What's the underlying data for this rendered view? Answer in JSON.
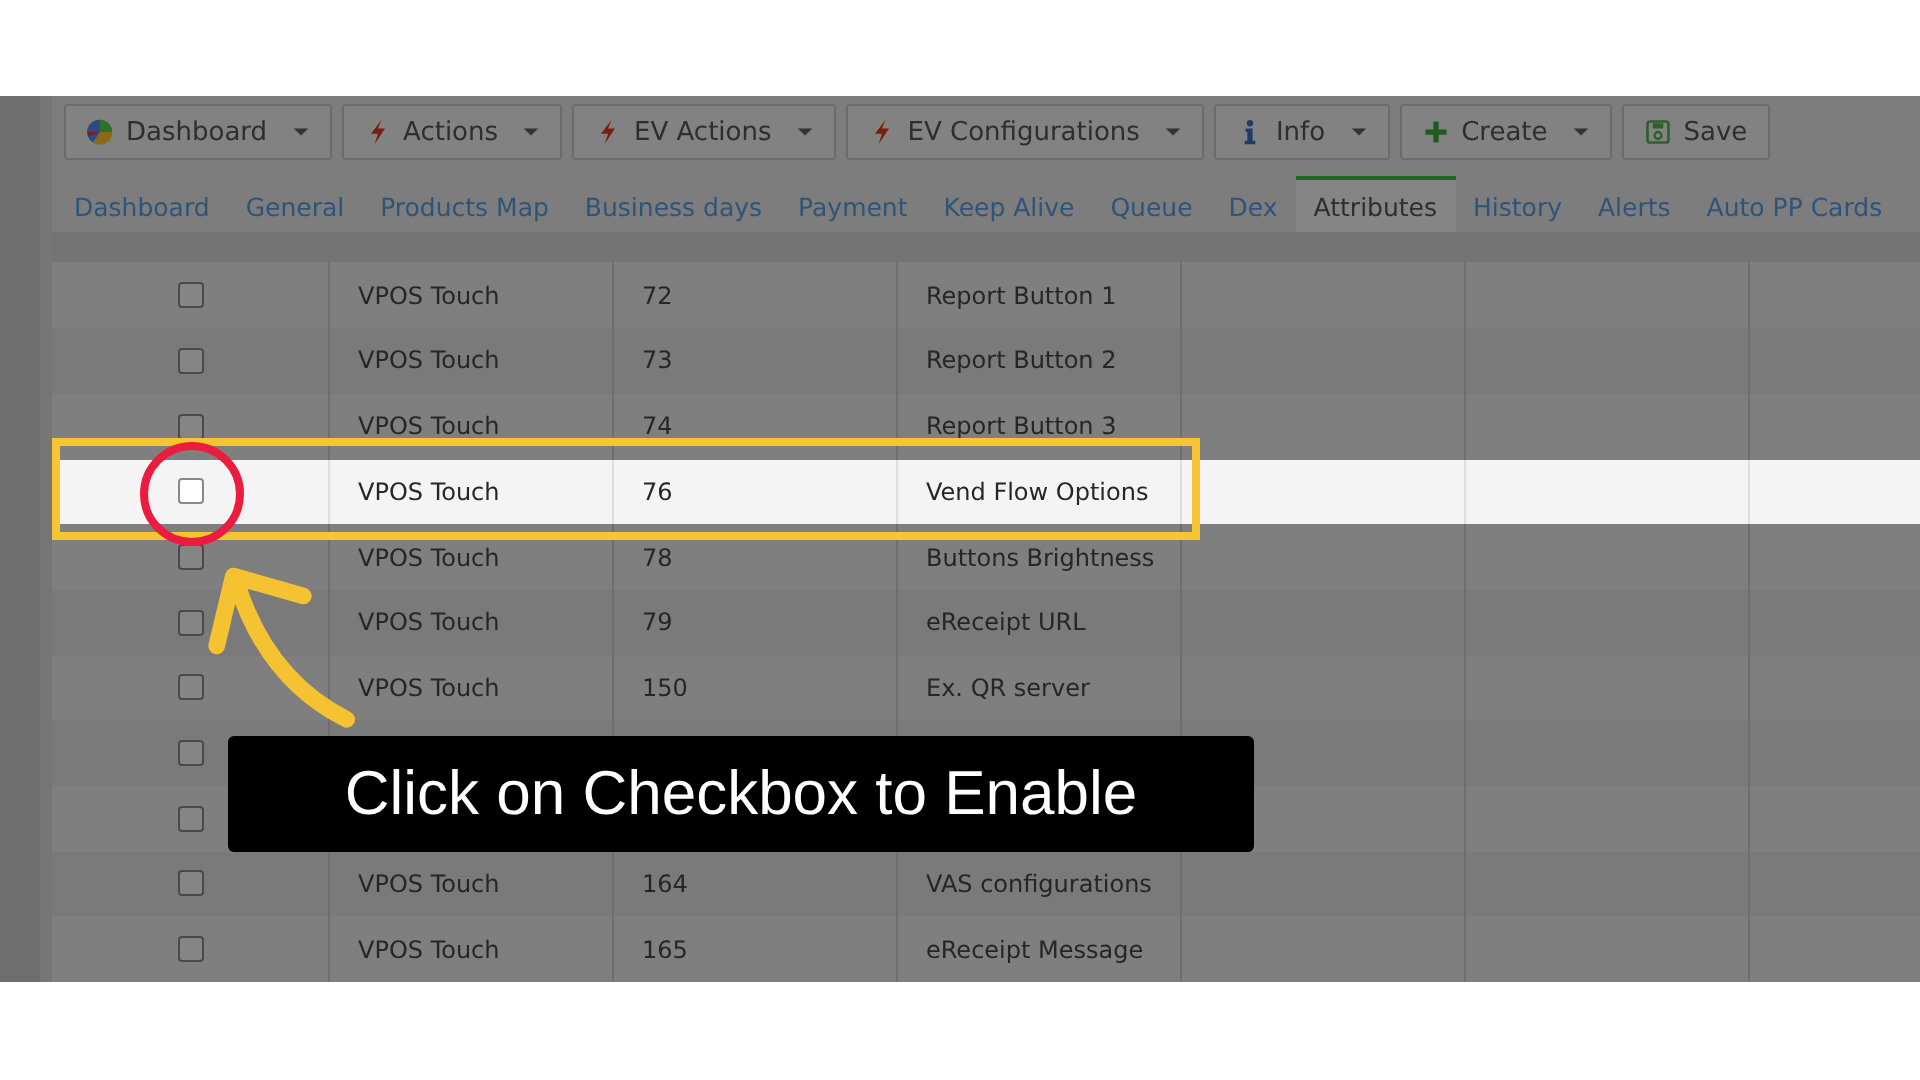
{
  "toolbar": [
    {
      "label": "Dashboard",
      "kind": "chart",
      "dropdown": true
    },
    {
      "label": "Actions",
      "kind": "action",
      "dropdown": true
    },
    {
      "label": "EV Actions",
      "kind": "action",
      "dropdown": true
    },
    {
      "label": "EV Configurations",
      "kind": "action",
      "dropdown": true
    },
    {
      "label": "Info",
      "kind": "info",
      "dropdown": true
    },
    {
      "label": "Create",
      "kind": "create",
      "dropdown": true
    },
    {
      "label": "Save",
      "kind": "save",
      "dropdown": false
    }
  ],
  "tabs": [
    {
      "label": "Dashboard",
      "selected": false
    },
    {
      "label": "General",
      "selected": false
    },
    {
      "label": "Products Map",
      "selected": false
    },
    {
      "label": "Business days",
      "selected": false
    },
    {
      "label": "Payment",
      "selected": false
    },
    {
      "label": "Keep Alive",
      "selected": false
    },
    {
      "label": "Queue",
      "selected": false
    },
    {
      "label": "Dex",
      "selected": false
    },
    {
      "label": "Attributes",
      "selected": true
    },
    {
      "label": "History",
      "selected": false
    },
    {
      "label": "Alerts",
      "selected": false
    },
    {
      "label": "Auto PP Cards",
      "selected": false
    }
  ],
  "table": {
    "rows": [
      {
        "checked": false,
        "selected": false,
        "group": "VPOS Touch",
        "attribute_id": "72",
        "attribute_name": "Report Button 1"
      },
      {
        "checked": false,
        "selected": false,
        "group": "VPOS Touch",
        "attribute_id": "73",
        "attribute_name": "Report Button 2"
      },
      {
        "checked": false,
        "selected": false,
        "group": "VPOS Touch",
        "attribute_id": "74",
        "attribute_name": "Report Button 3"
      },
      {
        "checked": false,
        "selected": true,
        "group": "VPOS Touch",
        "attribute_id": "76",
        "attribute_name": "Vend Flow Options"
      },
      {
        "checked": false,
        "selected": false,
        "group": "VPOS Touch",
        "attribute_id": "78",
        "attribute_name": "Buttons Brightness"
      },
      {
        "checked": false,
        "selected": false,
        "group": "VPOS Touch",
        "attribute_id": "79",
        "attribute_name": "eReceipt URL"
      },
      {
        "checked": false,
        "selected": false,
        "group": "VPOS Touch",
        "attribute_id": "150",
        "attribute_name": "Ex. QR server"
      },
      {
        "checked": false,
        "selected": false
      },
      {
        "checked": false,
        "selected": false
      },
      {
        "checked": false,
        "selected": false,
        "group": "VPOS Touch",
        "attribute_id": "164",
        "attribute_name": "VAS configurations"
      },
      {
        "checked": false,
        "selected": false,
        "group": "VPOS Touch",
        "attribute_id": "165",
        "attribute_name": "eReceipt Message"
      }
    ]
  },
  "annotation": {
    "caption": "Click on Checkbox to Enable"
  }
}
